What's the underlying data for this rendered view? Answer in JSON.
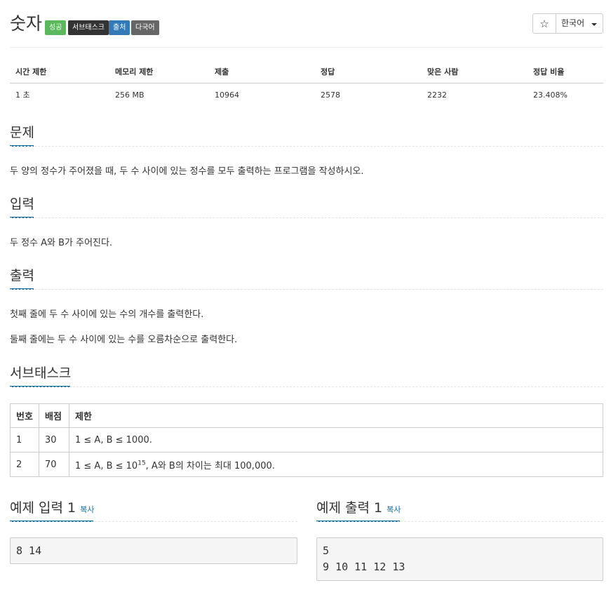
{
  "header": {
    "title": "숫자",
    "labels": {
      "success": "성공",
      "subtask": "서브태스크",
      "source": "출처",
      "multilang": "다국어"
    },
    "star": "☆",
    "language": "한국어"
  },
  "info": {
    "headers": [
      "시간 제한",
      "메모리 제한",
      "제출",
      "정답",
      "맞은 사람",
      "정답 비율"
    ],
    "values": [
      "1 초",
      "256 MB",
      "10964",
      "2578",
      "2232",
      "23.408%"
    ]
  },
  "problem": {
    "title": "문제",
    "text": "두 양의 정수가 주어졌을 때, 두 수 사이에 있는 정수를 모두 출력하는 프로그램을 작성하시오."
  },
  "input": {
    "title": "입력",
    "text": "두 정수 A와 B가 주어진다."
  },
  "output": {
    "title": "출력",
    "line1": "첫째 줄에 두 수 사이에 있는 수의 개수를 출력한다.",
    "line2": "둘째 줄에는 두 수 사이에 있는 수를 오름차순으로 출력한다."
  },
  "subtask": {
    "title": "서브태스크",
    "headers": [
      "번호",
      "배점",
      "제한"
    ],
    "rows": [
      {
        "num": "1",
        "score": "30",
        "limit": "1 ≤ A, B ≤ 1000."
      },
      {
        "num": "2",
        "score": "70",
        "limit_pre": "1 ≤ A, B ≤ 10",
        "limit_sup": "15",
        "limit_post": ", A와 B의 차이는 최대 100,000."
      }
    ]
  },
  "samples": {
    "input_title": "예제 입력 1",
    "output_title": "예제 출력 1",
    "copy_label": "복사",
    "input_text": "8 14",
    "output_text": "5\n9 10 11 12 13"
  },
  "colors": {
    "success": "#5cb85c",
    "subtask": "#333333",
    "source": "#337ab7",
    "multilang": "#666666",
    "accent": "#0d6d97"
  }
}
